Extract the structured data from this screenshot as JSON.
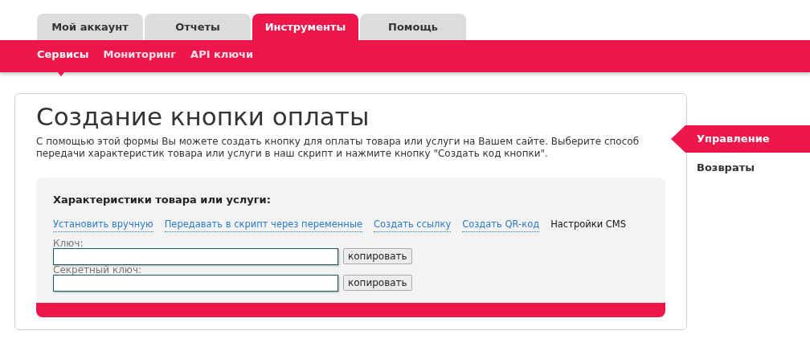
{
  "tabs": [
    {
      "label": "Мой аккаунт",
      "selected": false
    },
    {
      "label": "Отчеты",
      "selected": false
    },
    {
      "label": "Инструменты",
      "selected": true
    },
    {
      "label": "Помощь",
      "selected": false
    }
  ],
  "subnav": [
    {
      "label": "Сервисы",
      "selected": true
    },
    {
      "label": "Мониторинг",
      "selected": false
    },
    {
      "label": "API ключи",
      "selected": false
    }
  ],
  "page": {
    "title": "Создание кнопки оплаты",
    "description": "С помощью этой формы Вы можете создать кнопку для оплаты товара или услуги на Вашем сайте. Выберите способ передачи характеристик товара или услуги в наш скрипт и нажмите кнопку \"Создать код кнопки\"."
  },
  "form": {
    "heading": "Характеристики товара или услуги:",
    "modes": [
      {
        "label": "Установить вручную",
        "selected": false
      },
      {
        "label": "Передавать в скрипт через переменные",
        "selected": false
      },
      {
        "label": "Создать ссылку",
        "selected": false
      },
      {
        "label": "Создать QR-код",
        "selected": false
      },
      {
        "label": "Настройки CMS",
        "selected": true
      }
    ],
    "fields": [
      {
        "label": "Ключ:",
        "button": "копировать"
      },
      {
        "label": "Секретный ключ:",
        "button": "копировать"
      }
    ]
  },
  "side_menu": [
    {
      "label": "Управление",
      "selected": true
    },
    {
      "label": "Возвраты",
      "selected": false
    }
  ]
}
